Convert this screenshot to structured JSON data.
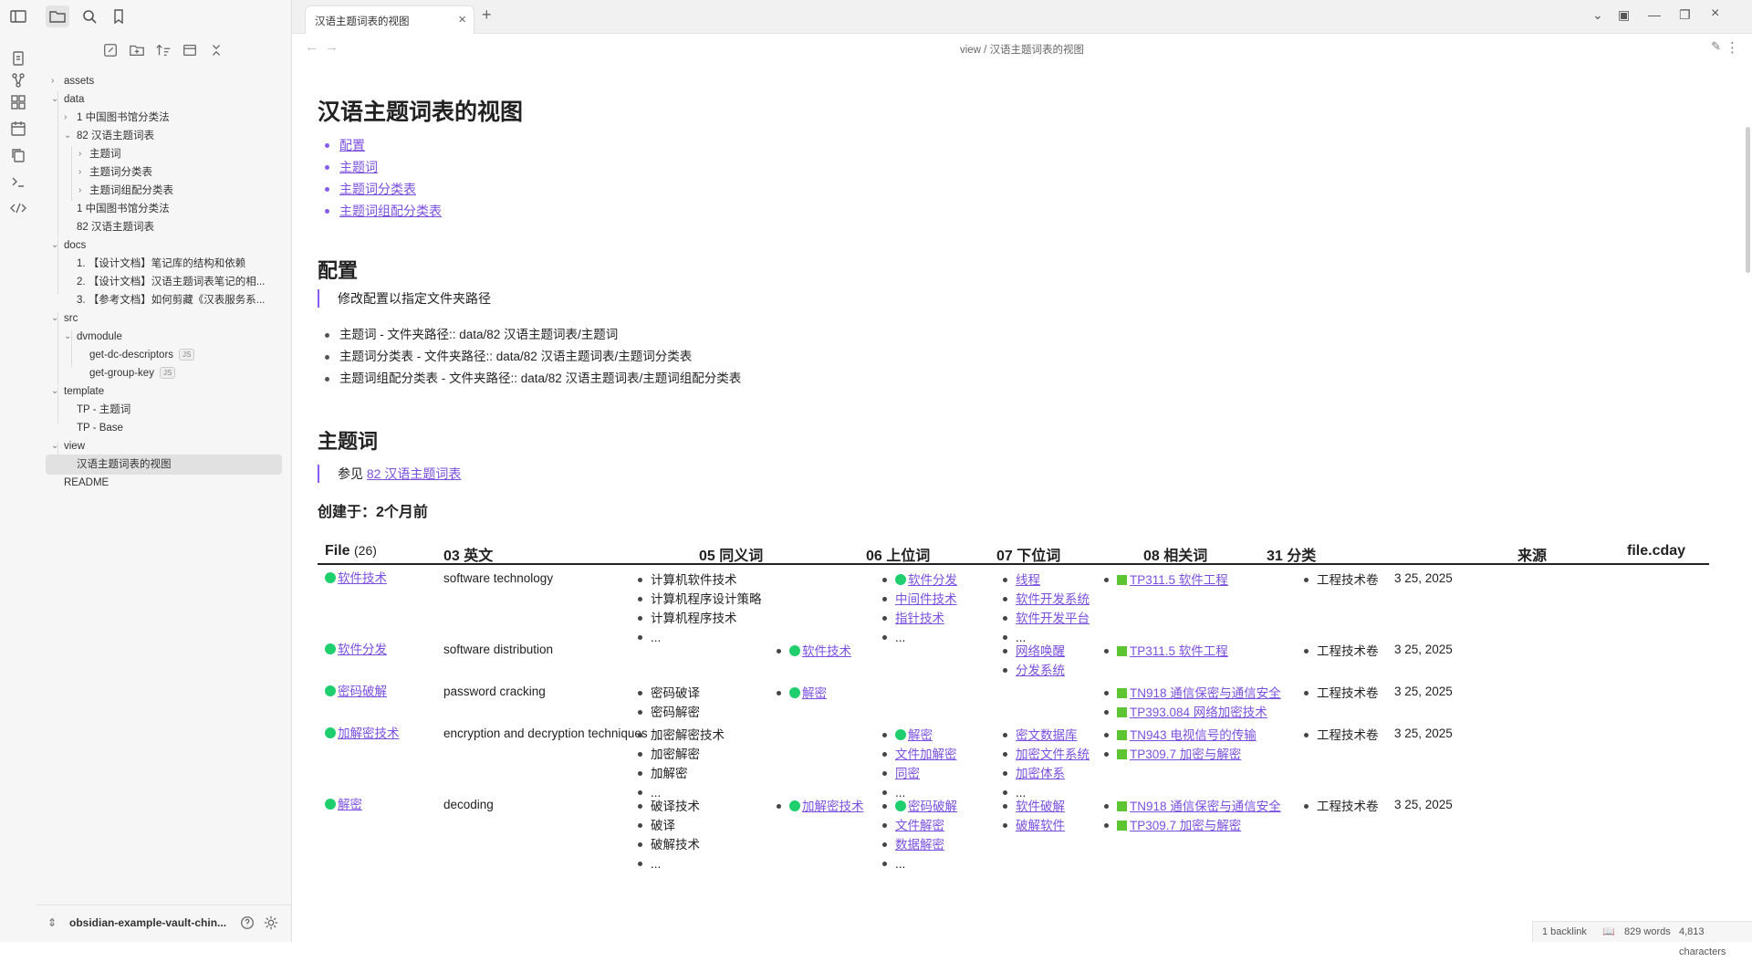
{
  "tab": {
    "title": "汉语主题词表的视图",
    "close": "×",
    "new": "+"
  },
  "breadcrumb": {
    "parent": "view",
    "sep": "/",
    "current": "汉语主题词表的视图"
  },
  "tree": {
    "assets": "assets",
    "data": "data",
    "data_1": "1 中国图书馆分类法",
    "data_82": "82 汉语主题词表",
    "zt1": "主题词",
    "zt2": "主题词分类表",
    "zt3": "主题词组配分类表",
    "data_file1": "1 中国图书馆分类法",
    "data_file82": "82 汉语主题词表",
    "docs": "docs",
    "docs1": "1. 【设计文档】笔记库的结构和依赖",
    "docs2": "2. 【设计文档】汉语主题词表笔记的相...",
    "docs3": "3. 【参考文档】如何剪藏《汉表服务系...",
    "src": "src",
    "dvmodule": "dvmodule",
    "js1": "get-dc-descriptors",
    "js2": "get-group-key",
    "js_badge": "JS",
    "template": "template",
    "tp1": "TP - 主题词",
    "tp2": "TP - Base",
    "view": "view",
    "view_file": "汉语主题词表的视图",
    "readme": "README"
  },
  "vault_name": "obsidian-example-vault-chin...",
  "doc": {
    "title": "汉语主题词表的视图",
    "toc": [
      "配置",
      "主题词",
      "主题词分类表",
      "主题词组配分类表"
    ],
    "h_config": "配置",
    "config_quote": "修改配置以指定文件夹路径",
    "config_items": [
      "主题词 - 文件夹路径:: data/82 汉语主题词表/主题词",
      "主题词分类表 - 文件夹路径:: data/82 汉语主题词表/主题词分类表",
      "主题词组配分类表 - 文件夹路径:: data/82 汉语主题词表/主题词组配分类表"
    ],
    "h_terms": "主题词",
    "terms_quote_prefix": "参见",
    "terms_quote_link": "82 汉语主题词表",
    "created": "创建于：2个月前"
  },
  "table": {
    "headers": {
      "file": "File",
      "file_count": "(26)",
      "en": "03 英文",
      "syn": "05 同义词",
      "broader": "06 上位词",
      "narrower": "07 下位词",
      "related": "08 相关词",
      "class": "31 分类",
      "source": "来源",
      "cday": "file.cday"
    },
    "rows": [
      {
        "file": "软件技术",
        "en": "software technology",
        "syn": [
          "计算机软件技术",
          "计算机程序设计策略",
          "计算机程序技术",
          "..."
        ],
        "broader": [],
        "narrower": [
          "软件分发",
          "中间件技术",
          "指针技术",
          "..."
        ],
        "narrower_dot": [
          true,
          false,
          false,
          false
        ],
        "related": [
          "线程",
          "软件开发系统",
          "软件开发平台",
          "..."
        ],
        "class": [
          "TP311.5 软件工程"
        ],
        "source": [
          "工程技术卷"
        ],
        "cday": "3 25, 2025"
      },
      {
        "file": "软件分发",
        "en": "software distribution",
        "syn": [],
        "broader": [
          "软件技术"
        ],
        "narrower": [],
        "narrower_dot": [],
        "related": [
          "网络唤醒",
          "分发系统"
        ],
        "class": [
          "TP311.5 软件工程"
        ],
        "source": [
          "工程技术卷"
        ],
        "cday": "3 25, 2025"
      },
      {
        "file": "密码破解",
        "en": "password cracking",
        "syn": [
          "密码破译",
          "密码解密"
        ],
        "broader": [
          "解密"
        ],
        "narrower": [],
        "narrower_dot": [],
        "related": [],
        "class": [
          "TN918 通信保密与通信安全",
          "TP393.084 网络加密技术"
        ],
        "source": [
          "工程技术卷"
        ],
        "cday": "3 25, 2025"
      },
      {
        "file": "加解密技术",
        "en": "encryption and decryption techniques",
        "syn": [
          "加密解密技术",
          "加密解密",
          "加解密",
          "..."
        ],
        "broader": [],
        "narrower": [
          "解密",
          "文件加解密",
          "同密",
          "..."
        ],
        "narrower_dot": [
          true,
          false,
          false,
          false
        ],
        "related": [
          "密文数据库",
          "加密文件系统",
          "加密体系",
          "..."
        ],
        "class": [
          "TN943 电视信号的传输",
          "TP309.7 加密与解密"
        ],
        "source": [
          "工程技术卷"
        ],
        "cday": "3 25, 2025"
      },
      {
        "file": "解密",
        "en": "decoding",
        "syn": [
          "破译技术",
          "破译",
          "破解技术",
          "..."
        ],
        "broader": [
          "加解密技术"
        ],
        "narrower": [
          "密码破解",
          "文件解密",
          "数据解密",
          "..."
        ],
        "narrower_dot": [
          true,
          false,
          false,
          false
        ],
        "related": [
          "软件破解",
          "破解软件"
        ],
        "class": [
          "TN918 通信保密与通信安全",
          "TP309.7 加密与解密"
        ],
        "source": [
          "工程技术卷"
        ],
        "cday": "3 25, 2025"
      }
    ]
  },
  "status": {
    "backlinks": "1 backlink",
    "words": "829 words",
    "chars": "4,813 characters"
  }
}
